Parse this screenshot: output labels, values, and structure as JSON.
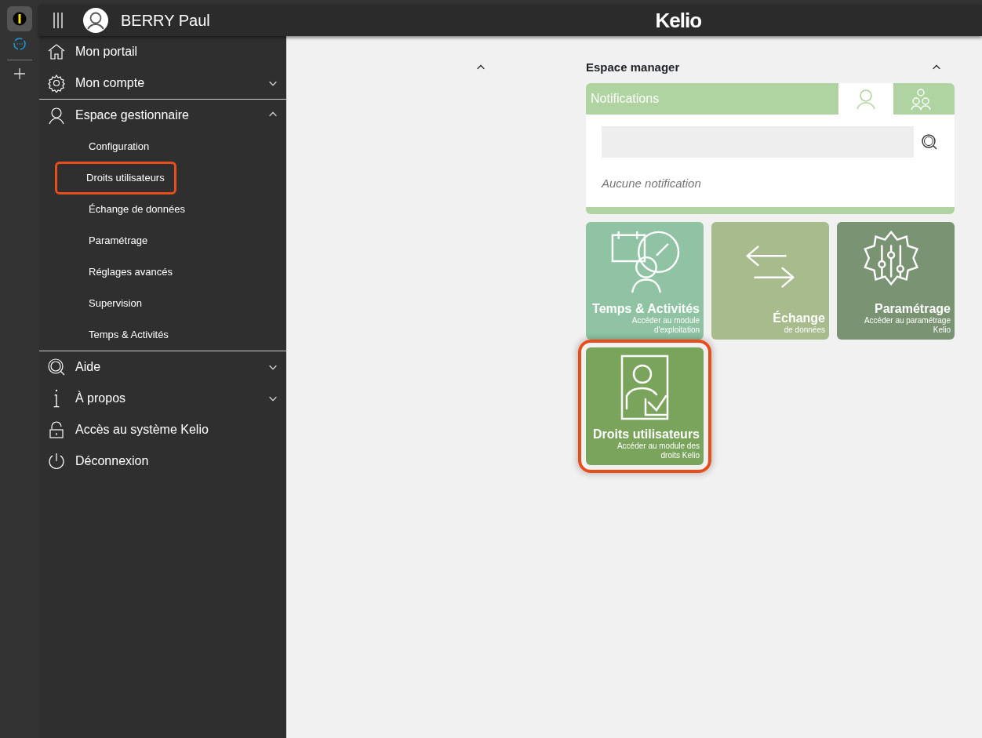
{
  "header": {
    "user_name": "BERRY Paul",
    "logo": "Kelio"
  },
  "sidebar": {
    "items": [
      {
        "kind": "link",
        "label": "Mon portail"
      },
      {
        "kind": "group",
        "label": "Mon compte",
        "expanded": false
      },
      {
        "kind": "group",
        "label": "Espace gestionnaire",
        "expanded": true,
        "children": [
          {
            "label": "Configuration",
            "highlighted": false
          },
          {
            "label": "Droits utilisateurs",
            "highlighted": true
          },
          {
            "label": "Échange de données",
            "highlighted": false
          },
          {
            "label": "Paramétrage",
            "highlighted": false
          },
          {
            "label": "Réglages avancés",
            "highlighted": false
          },
          {
            "label": "Supervision",
            "highlighted": false
          },
          {
            "label": "Temps & Activités",
            "highlighted": false
          }
        ]
      },
      {
        "kind": "group",
        "label": "Aide",
        "expanded": false
      },
      {
        "kind": "group",
        "label": "À propos",
        "expanded": false
      },
      {
        "kind": "link",
        "label": "Accès au système Kelio"
      },
      {
        "kind": "link",
        "label": "Déconnexion"
      }
    ]
  },
  "left_column": {
    "expanded": true
  },
  "espace_manager": {
    "title": "Espace manager",
    "expanded": true,
    "notifications": {
      "title": "Notifications",
      "tabs": [
        {
          "selected": true
        },
        {
          "selected": false
        }
      ],
      "empty_message": "Aucune notification"
    },
    "tiles": [
      {
        "title": "Temps & Activités",
        "subtitle": "Accéder au module d'exploitation",
        "color": "#8fc3a3",
        "highlighted": false
      },
      {
        "title": "Échange",
        "subtitle": "de données",
        "color": "#a8bb8c",
        "highlighted": false
      },
      {
        "title": "Paramétrage",
        "subtitle": "Accéder au paramétrage Kelio",
        "color": "#7a9473",
        "highlighted": false
      },
      {
        "title": "Droits utilisateurs",
        "subtitle": "Accéder au module des droits Kelio",
        "color": "#7aa45c",
        "highlighted": true
      }
    ]
  }
}
